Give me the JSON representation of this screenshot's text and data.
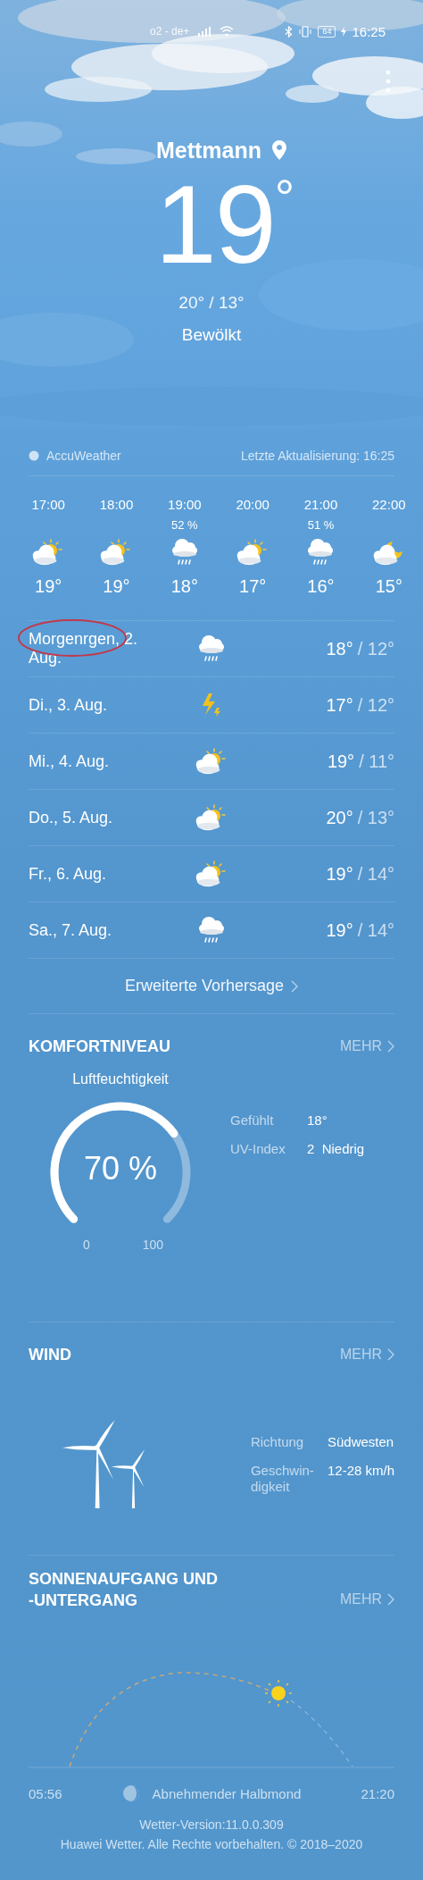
{
  "status_bar": {
    "carrier": "o2 - de+",
    "battery": "64",
    "time": "16:25"
  },
  "location": {
    "name": "Mettmann"
  },
  "current": {
    "temperature": "19",
    "unit": "°",
    "range": "20° / 13°",
    "condition": "Bewölkt"
  },
  "provider": {
    "name": "AccuWeather",
    "updated": "Letzte Aktualisierung: 16:25"
  },
  "hourly": [
    {
      "time": "17:00",
      "kind": "partly-sunny",
      "temp": "19°"
    },
    {
      "time": "18:00",
      "kind": "partly-sunny",
      "temp": "19°"
    },
    {
      "time": "19:00",
      "precip": "52 %",
      "kind": "rain",
      "temp": "18°"
    },
    {
      "time": "20:00",
      "kind": "partly-sunny",
      "temp": "17°"
    },
    {
      "time": "21:00",
      "precip": "51 %",
      "kind": "rain",
      "temp": "16°"
    },
    {
      "time": "22:00",
      "kind": "night-cloudy",
      "temp": "15°"
    }
  ],
  "daily": [
    {
      "date": "Morgenrgen, 2. Aug.",
      "kind": "rain",
      "high": "18°",
      "low": "/ 12°",
      "circled": true
    },
    {
      "date": "Di., 3. Aug.",
      "kind": "storm",
      "high": "17°",
      "low": "/ 12°",
      "circled": false
    },
    {
      "date": "Mi., 4. Aug.",
      "kind": "partly-sunny",
      "high": "19°",
      "low": "/ 11°",
      "circled": false
    },
    {
      "date": "Do., 5. Aug.",
      "kind": "partly-sunny",
      "high": "20°",
      "low": "/ 13°",
      "circled": false
    },
    {
      "date": "Fr., 6. Aug.",
      "kind": "partly-sunny",
      "high": "19°",
      "low": "/ 14°",
      "circled": false
    },
    {
      "date": "Sa., 7. Aug.",
      "kind": "rain",
      "high": "19°",
      "low": "/ 14°",
      "circled": false
    }
  ],
  "more_forecast": "Erweiterte Vorhersage",
  "comfort": {
    "title": "KOMFORTNIVEAU",
    "more": "MEHR",
    "gauge_label": "Luftfeuchtigkeit",
    "value": "70 %",
    "min": "0",
    "max": "100",
    "details": [
      {
        "label": "Gefühlt",
        "value": "18°"
      },
      {
        "label": "UV-Index",
        "value": "2  Niedrig"
      }
    ]
  },
  "wind": {
    "title": "WIND",
    "more": "MEHR",
    "details": [
      {
        "label": "Richtung",
        "value": "Südwesten"
      },
      {
        "label": "Geschwin-digkeit",
        "value": "12-28 km/h"
      }
    ]
  },
  "sun": {
    "title": "SONNENAUFGANG UND -UNTERGANG",
    "more": "MEHR",
    "sunrise": "05:56",
    "sunset": "21:20",
    "moon": "Abnehmender Halbmond"
  },
  "footer": {
    "version": "Wetter-Version:11.0.0.309",
    "copyright": "Huawei Wetter. Alle Rechte vorbehalten. © 2018–2020"
  }
}
